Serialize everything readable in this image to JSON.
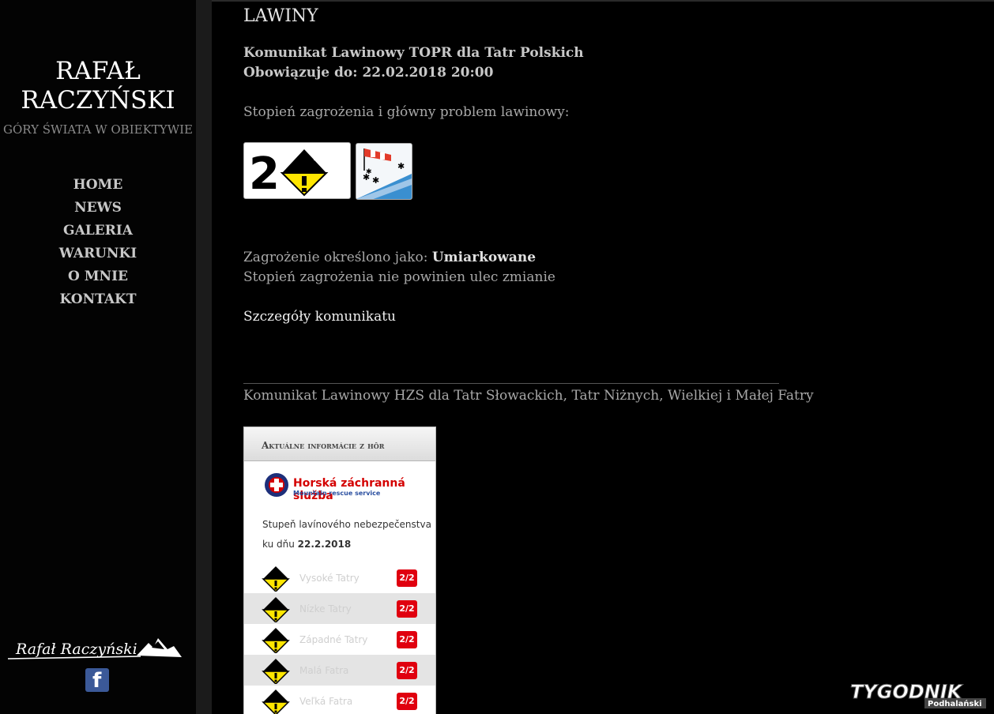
{
  "sidebar": {
    "brand_line1": "RAFAŁ",
    "brand_line2": "RACZYŃSKI",
    "tagline": "GÓRY ŚWIATA W OBIEKTYWIE",
    "nav": [
      "HOME",
      "NEWS",
      "GALERIA",
      "WARUNKI",
      "O MNIE",
      "KONTAKT"
    ],
    "signature_text": "Rafał Raczyński",
    "facebook_glyph": "f"
  },
  "main": {
    "title": "LAWINY",
    "topr_title": "Komunikat Lawinowy TOPR dla Tatr Polskich",
    "topr_valid": "Obowiązuje do: 22.02.2018 20:00",
    "level_label": "Stopień zagrożenia i główny problem lawinowy:",
    "danger_level_digit": "2",
    "threat_prefix": "Zagrożenie określono jako: ",
    "threat_value": "Umiarkowane",
    "trend_text": "Stopień zagrożenia nie powinien ulec zmianie",
    "details_link": "Szczegóły komunikatu",
    "hzs_title": "Komunikat Lawinowy HZS dla Tatr Słowackich, Tatr Niżnych, Wielkiej i Małej Fatry"
  },
  "widget": {
    "header": "Aktuálne informácie z hôr",
    "logo_title": "Horská záchranná služba",
    "logo_subtitle": "Mountain rescue service",
    "line1": "Stupeň lavínového nebezpečenstva",
    "line2_prefix": "ku dňu ",
    "line2_date": "22.2.2018",
    "regions": [
      {
        "name": "Vysoké Tatry",
        "level": "2/2"
      },
      {
        "name": "Nízke Tatry",
        "level": "2/2"
      },
      {
        "name": "Západné Tatry",
        "level": "2/2"
      },
      {
        "name": "Malá Fatra",
        "level": "2/2"
      },
      {
        "name": "Veľká Fatra",
        "level": "2/2"
      }
    ]
  },
  "footer": {
    "badge_line1": "TYGODNIK",
    "badge_line2": "Podhalański"
  },
  "colors": {
    "background": "#000000",
    "danger_badge": "#e0000f",
    "hzs_red": "#d40000",
    "warning_yellow": "#ffe600"
  }
}
